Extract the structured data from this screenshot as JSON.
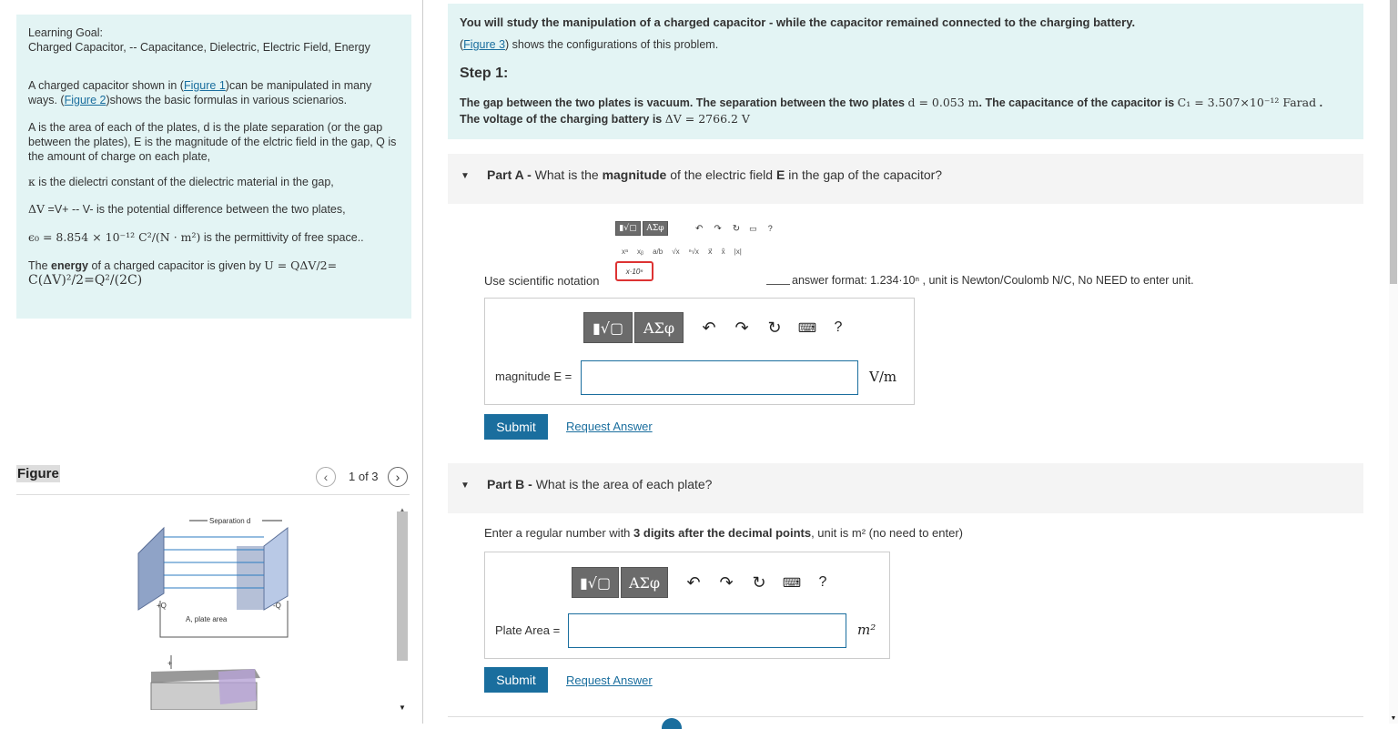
{
  "goal": {
    "heading": "Learning Goal:",
    "topics": "Charged Capacitor, -- Capacitance, Dielectric, Electric Field, Energy",
    "p1_pre": "A charged capacitor  shown in (",
    "fig1_link": "Figure 1",
    "p1_mid": ")can be manipulated in many ways. (",
    "fig2_link": "Figure 2",
    "p1_post": ")shows the basic formulas in various scienarios.",
    "p2": "A is the area of each of the plates, d is the plate separation (or the gap between the plates), E is the magnitude of the elctric field in the gap, Q is the amount of charge on each plate,",
    "p3_sym": "κ",
    "p3": " is the dielectri constant of the dielectric material in the gap,",
    "p4_sym": "ΔV",
    "p4": " =V+  -- V- is the potential difference between the two plates,",
    "p5_math": "ϵ₀ = 8.854 × 10⁻¹² C²/(N · m²)",
    "p5": " is the permittivity of free space..",
    "p6_pre": "The ",
    "p6_bold": "energy",
    "p6_mid": " of a charged capacitor is given by ",
    "p6_math1": "U = QΔV/2=",
    "p6_math2": "C(ΔV)²/2=Q²/(2C)"
  },
  "figure": {
    "title": "Figure",
    "pager": "1 of 3",
    "prev_icon": "chevron-left-icon",
    "next_icon": "chevron-right-icon",
    "labels": {
      "separation": "Separation d",
      "plus_q": "+Q",
      "minus_q": "-Q",
      "area": "A, plate area",
      "plus": "+"
    }
  },
  "intro": {
    "line1": "You will study the manipulation of a charged capacitor - while the capacitor remained connected to the charging battery.",
    "fig3_link": "Figure 3",
    "line2_pre": "(",
    "line2_post": ") shows the configurations of this problem.",
    "step": "Step 1:",
    "gap_text": "The gap between the two plates is vacuum. The separation between the two plates ",
    "d_val": "d = 0.053 m",
    "cap_text": ". The capacitance of the capacitor is ",
    "c_val": "C₁ = 3.507×10⁻¹² Farad",
    "voltage_text": "The voltage of the charging battery is ",
    "v_val": "ΔV = 2766.2 V"
  },
  "partA": {
    "label_bold": "Part A - ",
    "label": "What is the ",
    "label_b2": "magnitude",
    "label_3": " of the electric field ",
    "label_b3": "E",
    "label_4": " in the gap of the capacitor?",
    "sci_note": "Use scientific notation",
    "format_note": "answer format: 1.234·10ⁿ , unit is Newton/Coulomb N/C, No NEED to enter unit.",
    "field_label": "magnitude E =",
    "unit": "V/m",
    "submit": "Submit",
    "request": "Request Answer",
    "mini_tool": {
      "b1": "▮√▢",
      "b2": "ΑΣφ",
      "row2": [
        "xᵃ",
        "xᵦ",
        "a/b",
        "√x",
        "ⁿ√x",
        "x⃗",
        "x̂",
        "|x|"
      ],
      "sci": "x·10ⁿ"
    }
  },
  "partB": {
    "label_bold": "Part B - ",
    "label": "What is the area of each plate?",
    "instr_pre": "Enter a regular number with ",
    "instr_b": "3 digits after the decimal points",
    "instr_post": ", unit is m² (no need to enter)",
    "field_label": "Plate Area =",
    "unit": "m²",
    "submit": "Submit",
    "request": "Request Answer"
  },
  "toolbar": {
    "templates": "▮√▢",
    "greek": "ΑΣφ",
    "help": "?"
  }
}
